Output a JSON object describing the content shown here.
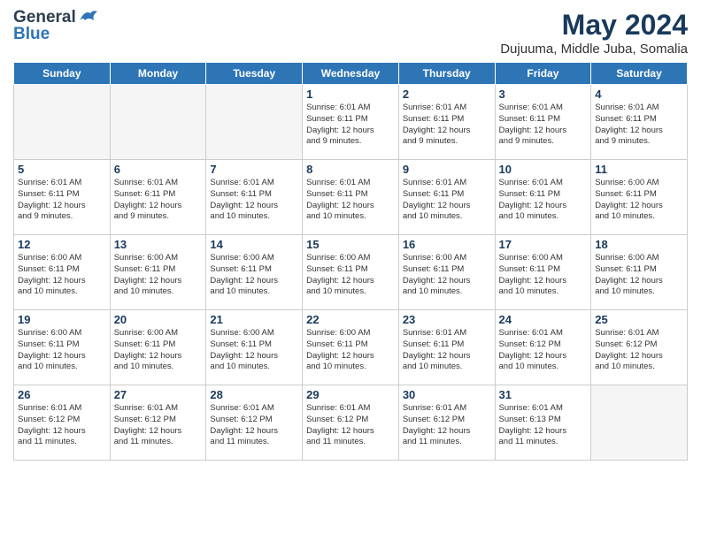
{
  "header": {
    "logo_general": "General",
    "logo_blue": "Blue",
    "month_year": "May 2024",
    "location": "Dujuuma, Middle Juba, Somalia"
  },
  "days_of_week": [
    "Sunday",
    "Monday",
    "Tuesday",
    "Wednesday",
    "Thursday",
    "Friday",
    "Saturday"
  ],
  "weeks": [
    [
      {
        "day": "",
        "info": ""
      },
      {
        "day": "",
        "info": ""
      },
      {
        "day": "",
        "info": ""
      },
      {
        "day": "1",
        "info": "Sunrise: 6:01 AM\nSunset: 6:11 PM\nDaylight: 12 hours\nand 9 minutes."
      },
      {
        "day": "2",
        "info": "Sunrise: 6:01 AM\nSunset: 6:11 PM\nDaylight: 12 hours\nand 9 minutes."
      },
      {
        "day": "3",
        "info": "Sunrise: 6:01 AM\nSunset: 6:11 PM\nDaylight: 12 hours\nand 9 minutes."
      },
      {
        "day": "4",
        "info": "Sunrise: 6:01 AM\nSunset: 6:11 PM\nDaylight: 12 hours\nand 9 minutes."
      }
    ],
    [
      {
        "day": "5",
        "info": "Sunrise: 6:01 AM\nSunset: 6:11 PM\nDaylight: 12 hours\nand 9 minutes."
      },
      {
        "day": "6",
        "info": "Sunrise: 6:01 AM\nSunset: 6:11 PM\nDaylight: 12 hours\nand 9 minutes."
      },
      {
        "day": "7",
        "info": "Sunrise: 6:01 AM\nSunset: 6:11 PM\nDaylight: 12 hours\nand 10 minutes."
      },
      {
        "day": "8",
        "info": "Sunrise: 6:01 AM\nSunset: 6:11 PM\nDaylight: 12 hours\nand 10 minutes."
      },
      {
        "day": "9",
        "info": "Sunrise: 6:01 AM\nSunset: 6:11 PM\nDaylight: 12 hours\nand 10 minutes."
      },
      {
        "day": "10",
        "info": "Sunrise: 6:01 AM\nSunset: 6:11 PM\nDaylight: 12 hours\nand 10 minutes."
      },
      {
        "day": "11",
        "info": "Sunrise: 6:00 AM\nSunset: 6:11 PM\nDaylight: 12 hours\nand 10 minutes."
      }
    ],
    [
      {
        "day": "12",
        "info": "Sunrise: 6:00 AM\nSunset: 6:11 PM\nDaylight: 12 hours\nand 10 minutes."
      },
      {
        "day": "13",
        "info": "Sunrise: 6:00 AM\nSunset: 6:11 PM\nDaylight: 12 hours\nand 10 minutes."
      },
      {
        "day": "14",
        "info": "Sunrise: 6:00 AM\nSunset: 6:11 PM\nDaylight: 12 hours\nand 10 minutes."
      },
      {
        "day": "15",
        "info": "Sunrise: 6:00 AM\nSunset: 6:11 PM\nDaylight: 12 hours\nand 10 minutes."
      },
      {
        "day": "16",
        "info": "Sunrise: 6:00 AM\nSunset: 6:11 PM\nDaylight: 12 hours\nand 10 minutes."
      },
      {
        "day": "17",
        "info": "Sunrise: 6:00 AM\nSunset: 6:11 PM\nDaylight: 12 hours\nand 10 minutes."
      },
      {
        "day": "18",
        "info": "Sunrise: 6:00 AM\nSunset: 6:11 PM\nDaylight: 12 hours\nand 10 minutes."
      }
    ],
    [
      {
        "day": "19",
        "info": "Sunrise: 6:00 AM\nSunset: 6:11 PM\nDaylight: 12 hours\nand 10 minutes."
      },
      {
        "day": "20",
        "info": "Sunrise: 6:00 AM\nSunset: 6:11 PM\nDaylight: 12 hours\nand 10 minutes."
      },
      {
        "day": "21",
        "info": "Sunrise: 6:00 AM\nSunset: 6:11 PM\nDaylight: 12 hours\nand 10 minutes."
      },
      {
        "day": "22",
        "info": "Sunrise: 6:00 AM\nSunset: 6:11 PM\nDaylight: 12 hours\nand 10 minutes."
      },
      {
        "day": "23",
        "info": "Sunrise: 6:01 AM\nSunset: 6:11 PM\nDaylight: 12 hours\nand 10 minutes."
      },
      {
        "day": "24",
        "info": "Sunrise: 6:01 AM\nSunset: 6:12 PM\nDaylight: 12 hours\nand 10 minutes."
      },
      {
        "day": "25",
        "info": "Sunrise: 6:01 AM\nSunset: 6:12 PM\nDaylight: 12 hours\nand 10 minutes."
      }
    ],
    [
      {
        "day": "26",
        "info": "Sunrise: 6:01 AM\nSunset: 6:12 PM\nDaylight: 12 hours\nand 11 minutes."
      },
      {
        "day": "27",
        "info": "Sunrise: 6:01 AM\nSunset: 6:12 PM\nDaylight: 12 hours\nand 11 minutes."
      },
      {
        "day": "28",
        "info": "Sunrise: 6:01 AM\nSunset: 6:12 PM\nDaylight: 12 hours\nand 11 minutes."
      },
      {
        "day": "29",
        "info": "Sunrise: 6:01 AM\nSunset: 6:12 PM\nDaylight: 12 hours\nand 11 minutes."
      },
      {
        "day": "30",
        "info": "Sunrise: 6:01 AM\nSunset: 6:12 PM\nDaylight: 12 hours\nand 11 minutes."
      },
      {
        "day": "31",
        "info": "Sunrise: 6:01 AM\nSunset: 6:13 PM\nDaylight: 12 hours\nand 11 minutes."
      },
      {
        "day": "",
        "info": ""
      }
    ]
  ]
}
